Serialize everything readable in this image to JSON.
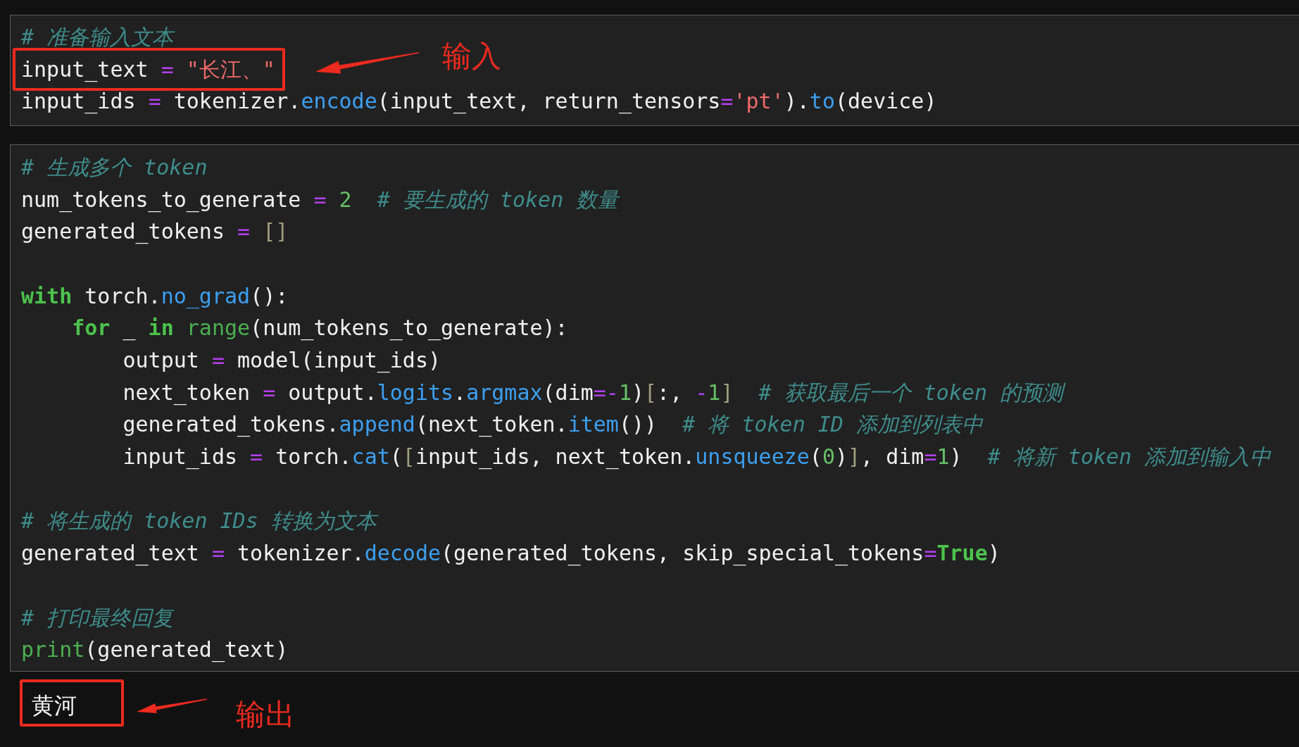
{
  "cells": [
    {
      "groups": [
        {
          "lines": [
            {
              "tokens": [
                {
                  "text": "# 准备输入文本",
                  "kind": "comment"
                }
              ]
            },
            {
              "tokens": [
                {
                  "text": "input_text ",
                  "kind": "plain"
                },
                {
                  "text": "= ",
                  "kind": "operator"
                },
                {
                  "text": "\"长江、\"",
                  "kind": "string"
                }
              ],
              "callout": "输入"
            },
            {
              "tokens": [
                {
                  "text": "input_ids ",
                  "kind": "plain"
                },
                {
                  "text": "=",
                  "kind": "operator"
                },
                {
                  "text": " tokenizer.",
                  "kind": "plain"
                },
                {
                  "text": "encode",
                  "kind": "function"
                },
                {
                  "text": "(input_text, return_tensors",
                  "kind": "plain"
                },
                {
                  "text": "=",
                  "kind": "operator"
                },
                {
                  "text": "'pt'",
                  "kind": "string"
                },
                {
                  "text": ").",
                  "kind": "plain"
                },
                {
                  "text": "to",
                  "kind": "function"
                },
                {
                  "text": "(device)",
                  "kind": "plain"
                }
              ]
            }
          ]
        }
      ]
    },
    {
      "groups": [
        {
          "lines": [
            {
              "tokens": [
                {
                  "text": "# 生成多个 token",
                  "kind": "comment"
                }
              ]
            },
            {
              "tokens": [
                {
                  "text": "num_tokens_to_generate ",
                  "kind": "plain"
                },
                {
                  "text": "= ",
                  "kind": "operator"
                },
                {
                  "text": "2",
                  "kind": "number"
                },
                {
                  "text": "  # 要生成的 token 数量",
                  "kind": "comment"
                }
              ]
            },
            {
              "tokens": [
                {
                  "text": "generated_tokens ",
                  "kind": "plain"
                },
                {
                  "text": "= ",
                  "kind": "operator"
                },
                {
                  "text": "[]",
                  "kind": "bracket"
                }
              ]
            }
          ]
        },
        {
          "lines": [
            {
              "tokens": [
                {
                  "text": "with",
                  "kind": "keyword"
                },
                {
                  "text": " torch.",
                  "kind": "plain"
                },
                {
                  "text": "no_grad",
                  "kind": "function"
                },
                {
                  "text": "():",
                  "kind": "plain"
                }
              ],
              "children": [
                {
                  "tokens": [
                    {
                      "text": "for",
                      "kind": "keyword"
                    },
                    {
                      "text": " _ ",
                      "kind": "plain"
                    },
                    {
                      "text": "in ",
                      "kind": "keyword"
                    },
                    {
                      "text": "range",
                      "kind": "builtin"
                    },
                    {
                      "text": "(num_tokens_to_generate):",
                      "kind": "plain"
                    }
                  ],
                  "children": [
                    {
                      "tokens": [
                        {
                          "text": "output ",
                          "kind": "plain"
                        },
                        {
                          "text": "=",
                          "kind": "operator"
                        },
                        {
                          "text": " model(input_ids)",
                          "kind": "plain"
                        }
                      ]
                    },
                    {
                      "tokens": [
                        {
                          "text": "next_token ",
                          "kind": "plain"
                        },
                        {
                          "text": "=",
                          "kind": "operator"
                        },
                        {
                          "text": " output.",
                          "kind": "plain"
                        },
                        {
                          "text": "logits",
                          "kind": "function"
                        },
                        {
                          "text": ".",
                          "kind": "plain"
                        },
                        {
                          "text": "argmax",
                          "kind": "function"
                        },
                        {
                          "text": "(dim",
                          "kind": "plain"
                        },
                        {
                          "text": "=-",
                          "kind": "operator"
                        },
                        {
                          "text": "1",
                          "kind": "number"
                        },
                        {
                          "text": ")",
                          "kind": "plain"
                        },
                        {
                          "text": "[",
                          "kind": "bracket"
                        },
                        {
                          "text": ":, ",
                          "kind": "plain"
                        },
                        {
                          "text": "-",
                          "kind": "operator"
                        },
                        {
                          "text": "1",
                          "kind": "number"
                        },
                        {
                          "text": "]",
                          "kind": "bracket"
                        },
                        {
                          "text": "  # 获取最后一个 token 的预测",
                          "kind": "comment"
                        }
                      ]
                    },
                    {
                      "tokens": [
                        {
                          "text": "generated_tokens.",
                          "kind": "plain"
                        },
                        {
                          "text": "append",
                          "kind": "function"
                        },
                        {
                          "text": "(next_token.",
                          "kind": "plain"
                        },
                        {
                          "text": "item",
                          "kind": "function"
                        },
                        {
                          "text": "())  ",
                          "kind": "plain"
                        },
                        {
                          "text": "# 将 token ID 添加到列表中",
                          "kind": "comment"
                        }
                      ]
                    },
                    {
                      "tokens": [
                        {
                          "text": "input_ids ",
                          "kind": "plain"
                        },
                        {
                          "text": "=",
                          "kind": "operator"
                        },
                        {
                          "text": " torch.",
                          "kind": "plain"
                        },
                        {
                          "text": "cat",
                          "kind": "function"
                        },
                        {
                          "text": "(",
                          "kind": "plain"
                        },
                        {
                          "text": "[",
                          "kind": "bracket"
                        },
                        {
                          "text": "input_ids, next_token.",
                          "kind": "plain"
                        },
                        {
                          "text": "unsqueeze",
                          "kind": "function"
                        },
                        {
                          "text": "(",
                          "kind": "plain"
                        },
                        {
                          "text": "0",
                          "kind": "number"
                        },
                        {
                          "text": ")",
                          "kind": "plain"
                        },
                        {
                          "text": "]",
                          "kind": "bracket"
                        },
                        {
                          "text": ", dim",
                          "kind": "plain"
                        },
                        {
                          "text": "=",
                          "kind": "operator"
                        },
                        {
                          "text": "1",
                          "kind": "number"
                        },
                        {
                          "text": ")  ",
                          "kind": "plain"
                        },
                        {
                          "text": "# 将新 token 添加到输入中",
                          "kind": "comment"
                        }
                      ]
                    }
                  ]
                }
              ]
            }
          ]
        },
        {
          "lines": [
            {
              "tokens": [
                {
                  "text": "# 将生成的 token IDs 转换为文本",
                  "kind": "comment"
                }
              ]
            },
            {
              "tokens": [
                {
                  "text": "generated_text ",
                  "kind": "plain"
                },
                {
                  "text": "=",
                  "kind": "operator"
                },
                {
                  "text": " tokenizer.",
                  "kind": "plain"
                },
                {
                  "text": "decode",
                  "kind": "function"
                },
                {
                  "text": "(generated_tokens, skip_special_tokens",
                  "kind": "plain"
                },
                {
                  "text": "=",
                  "kind": "operator"
                },
                {
                  "text": "True",
                  "kind": "keyword"
                },
                {
                  "text": ")",
                  "kind": "plain"
                }
              ]
            }
          ]
        },
        {
          "lines": [
            {
              "tokens": [
                {
                  "text": "# 打印最终回复",
                  "kind": "comment"
                }
              ]
            },
            {
              "tokens": [
                {
                  "text": "print",
                  "kind": "builtin"
                },
                {
                  "text": "(generated_text)",
                  "kind": "plain"
                }
              ]
            }
          ]
        }
      ]
    }
  ],
  "output": {
    "text": "黄河",
    "callout": "输出"
  }
}
